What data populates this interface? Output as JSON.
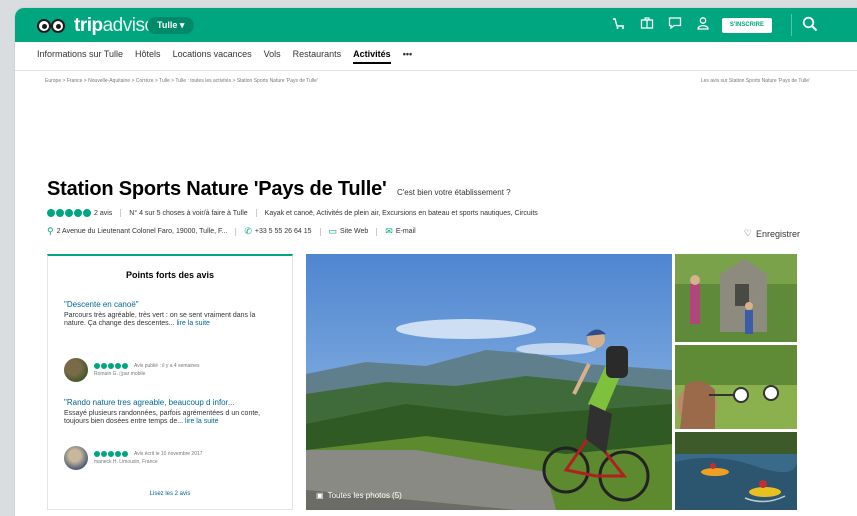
{
  "header": {
    "logo_trip": "trip",
    "logo_advisor": "advisor",
    "location_button": "Tulle",
    "signup_label": "S'INSCRIRE"
  },
  "nav": {
    "items": [
      "Informations sur Tulle",
      "Hôtels",
      "Locations vacances",
      "Vols",
      "Restaurants",
      "Activités",
      "•••"
    ],
    "active": "Activités"
  },
  "breadcrumb": {
    "left": "Europe > France > Nouvelle-Aquitaine > Corrèze > Tulle > Tulle : toutes les activités > Station Sports Nature 'Pays de Tulle'",
    "right": "Les avis sur Station Sports Nature 'Pays de Tulle'"
  },
  "listing": {
    "title": "Station Sports Nature 'Pays de Tulle'",
    "claim": "C'est bien votre établissement ?",
    "rating_bubbles": 5,
    "review_count": "2 avis",
    "rank": "N° 4 sur 5 choses à voir/à faire à Tulle",
    "categories": "Kayak et canoë, Activités de plein air, Excursions en bateau et sports nautiques, Circuits",
    "address": "2 Avenue du Lieutenant Colonel Faro, 19000, Tulle, F...",
    "phone": "+33 5 55 26 64 15",
    "website": "Site Web",
    "email": "E-mail",
    "save": "Enregistrer"
  },
  "highlights": {
    "heading": "Points forts des avis",
    "reviews": [
      {
        "title": "\"Descente en canoë\"",
        "body": "Parcours très agréable, très vert : on se sent vraiment dans la nature. Ça change des descentes...",
        "more": "lire la suite",
        "date": "Avis publié : il y a 4 semaines",
        "author": "Romain G.",
        "device": "par mobile"
      },
      {
        "title": "\"Rando nature tres agreable, beaucoup d infor...",
        "body": "Essayé plusieurs randonnées, parfois agrémentées d un conte, toujours bien dosées entre temps de...",
        "more": "lire la suite",
        "date": "Avis écrit le 10 novembre 2017",
        "author": "maneck H. Limousin, France",
        "device": ""
      }
    ],
    "all_link": "Lisez les 2 avis"
  },
  "photos": {
    "label": "Toutes les photos (5)"
  },
  "colors": {
    "brand": "#00a680",
    "link": "#006699"
  }
}
